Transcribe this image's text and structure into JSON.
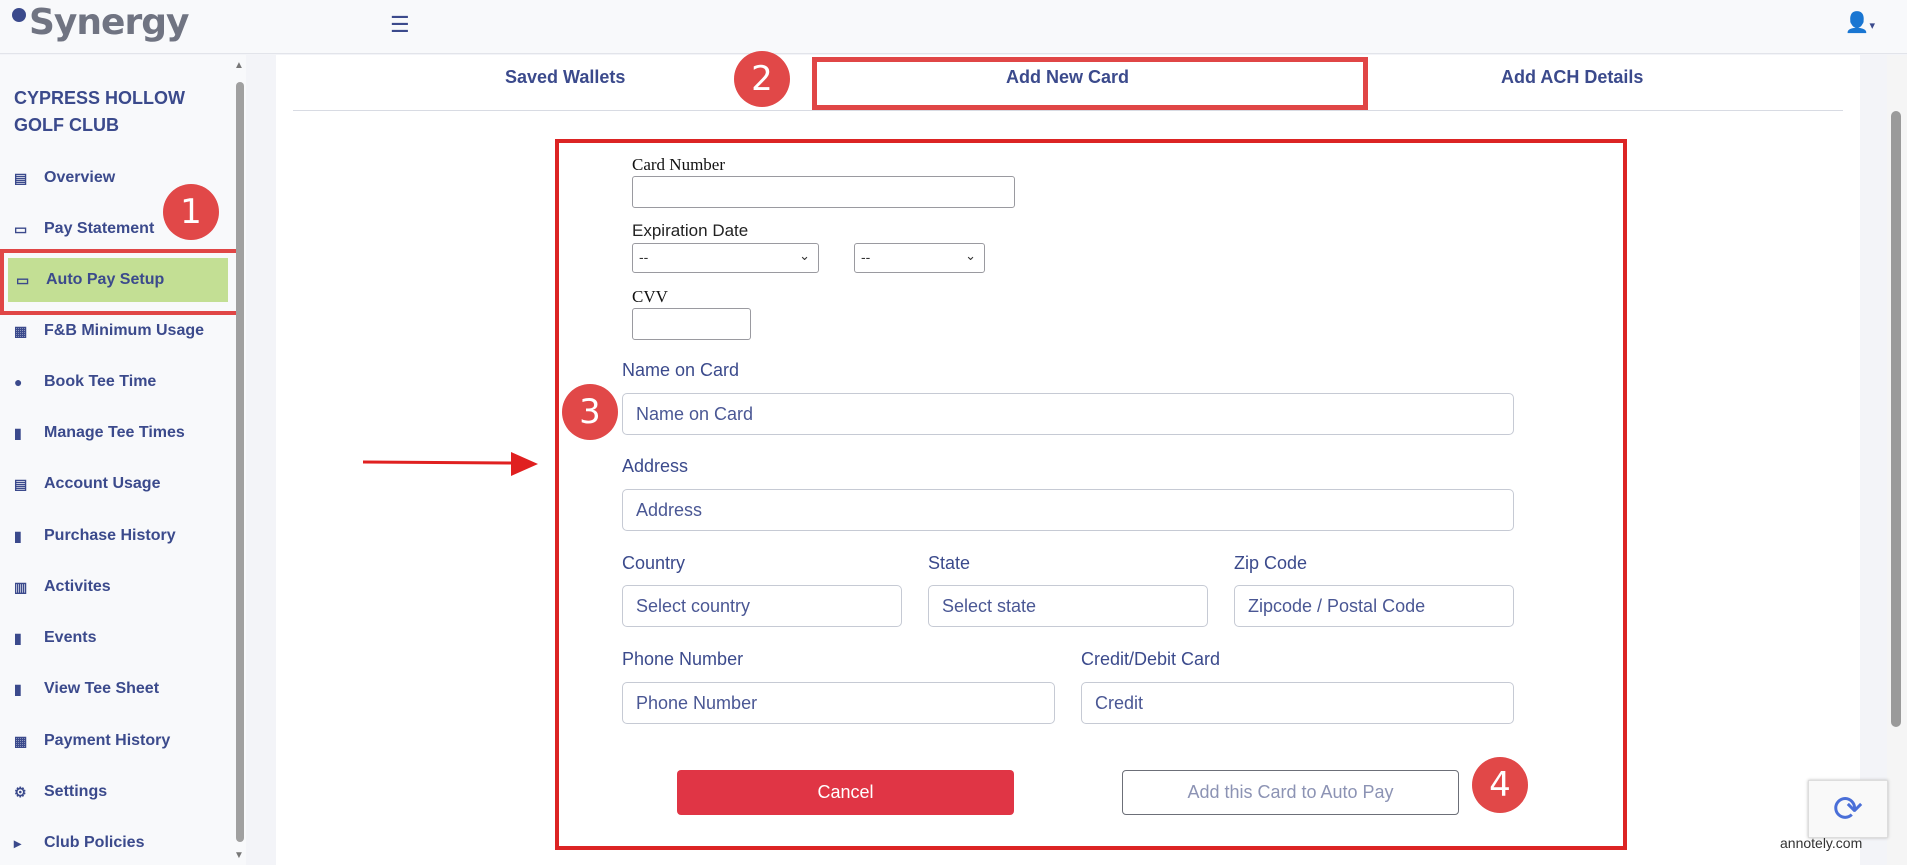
{
  "header": {
    "logo_text": "Synergy",
    "menu_icon": "hamburger-icon",
    "user_icon": "user-icon"
  },
  "sidebar": {
    "club_name": "CYPRESS HOLLOW GOLF CLUB",
    "items": [
      {
        "label": "Overview",
        "icon": "id-card-icon"
      },
      {
        "label": "Pay Statement",
        "icon": "credit-card-icon"
      },
      {
        "label": "Auto Pay Setup",
        "icon": "credit-card-icon"
      },
      {
        "label": "F&B Minimum Usage",
        "icon": "invoice-icon"
      },
      {
        "label": "Book Tee Time",
        "icon": "golf-ball-icon"
      },
      {
        "label": "Manage Tee Times",
        "icon": "receipt-icon"
      },
      {
        "label": "Account Usage",
        "icon": "id-card-icon"
      },
      {
        "label": "Purchase History",
        "icon": "receipt-icon"
      },
      {
        "label": "Activites",
        "icon": "calendar-icon"
      },
      {
        "label": "Events",
        "icon": "receipt-icon"
      },
      {
        "label": "View Tee Sheet",
        "icon": "clipboard-icon"
      },
      {
        "label": "Payment History",
        "icon": "invoice-icon"
      },
      {
        "label": "Settings",
        "icon": "gear-icon"
      },
      {
        "label": "Club Policies",
        "icon": "megaphone-icon"
      }
    ],
    "active_item": "Auto Pay Setup"
  },
  "tabs": [
    {
      "label": "Saved Wallets"
    },
    {
      "label": "Add New Card"
    },
    {
      "label": "Add ACH Details"
    }
  ],
  "active_tab": "Add New Card",
  "markers": [
    "1",
    "2",
    "3",
    "4"
  ],
  "form": {
    "card_number_label": "Card Number",
    "card_number_value": "",
    "expiration_label": "Expiration Date",
    "exp_month_value": "--",
    "exp_year_value": "--",
    "cvv_label": "CVV",
    "cvv_value": "",
    "name_label": "Name on Card",
    "name_placeholder": "Name on Card",
    "address_label": "Address",
    "address_placeholder": "Address",
    "country_label": "Country",
    "country_value": "Select country",
    "state_label": "State",
    "state_value": "Select state",
    "zip_label": "Zip Code",
    "zip_placeholder": "Zipcode / Postal Code",
    "phone_label": "Phone Number",
    "phone_placeholder": "Phone Number",
    "card_type_label": "Credit/Debit Card",
    "card_type_value": "Credit",
    "cancel_label": "Cancel",
    "add_label": "Add this Card to Auto Pay"
  },
  "watermark": "annotely.com",
  "colors": {
    "brand": "#3b4a8c",
    "annotation_red": "#e04646",
    "active_nav": "#c3df94",
    "cancel_button": "#e03545"
  }
}
